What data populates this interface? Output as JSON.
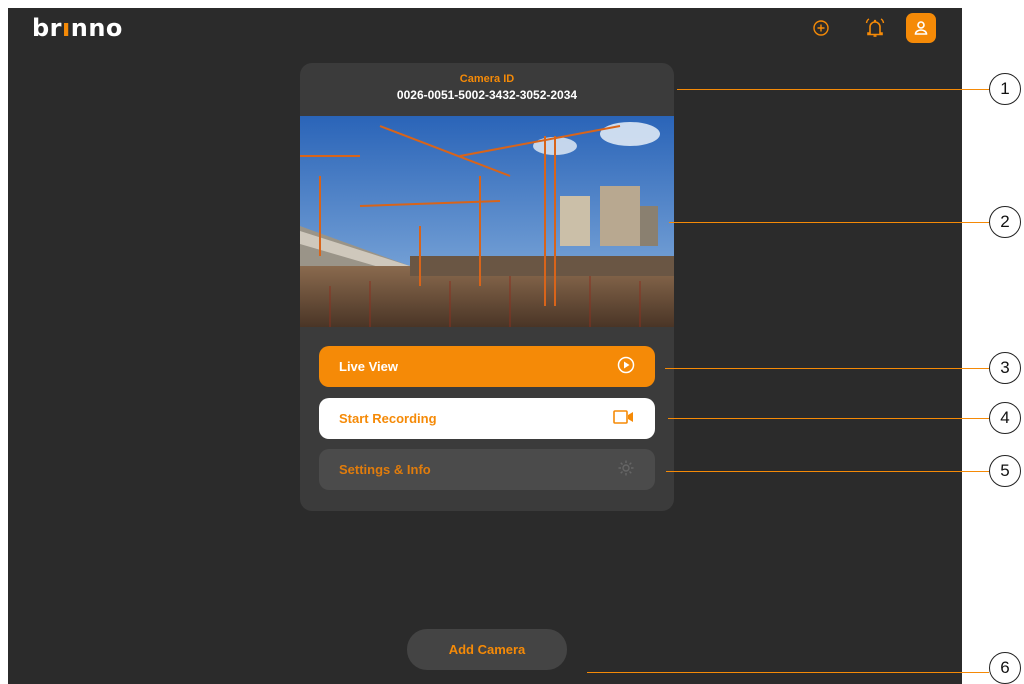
{
  "header": {
    "logo_text_a": "br",
    "logo_text_b": "nno",
    "icons": [
      "add-circle-icon",
      "bell-icon",
      "user-icon"
    ]
  },
  "camera_card": {
    "id_label": "Camera ID",
    "id_value": "0026-0051-5002-3432-3052-2034",
    "preview": "construction-site-photo",
    "buttons": {
      "live_view": "Live View",
      "start_recording": "Start Recording",
      "settings_info": "Settings & Info"
    }
  },
  "footer": {
    "add_camera": "Add Camera"
  },
  "callouts": [
    "1",
    "2",
    "3",
    "4",
    "5",
    "6"
  ],
  "colors": {
    "accent": "#f58a07",
    "background": "#2b2b2b",
    "card": "#3b3b3b"
  }
}
